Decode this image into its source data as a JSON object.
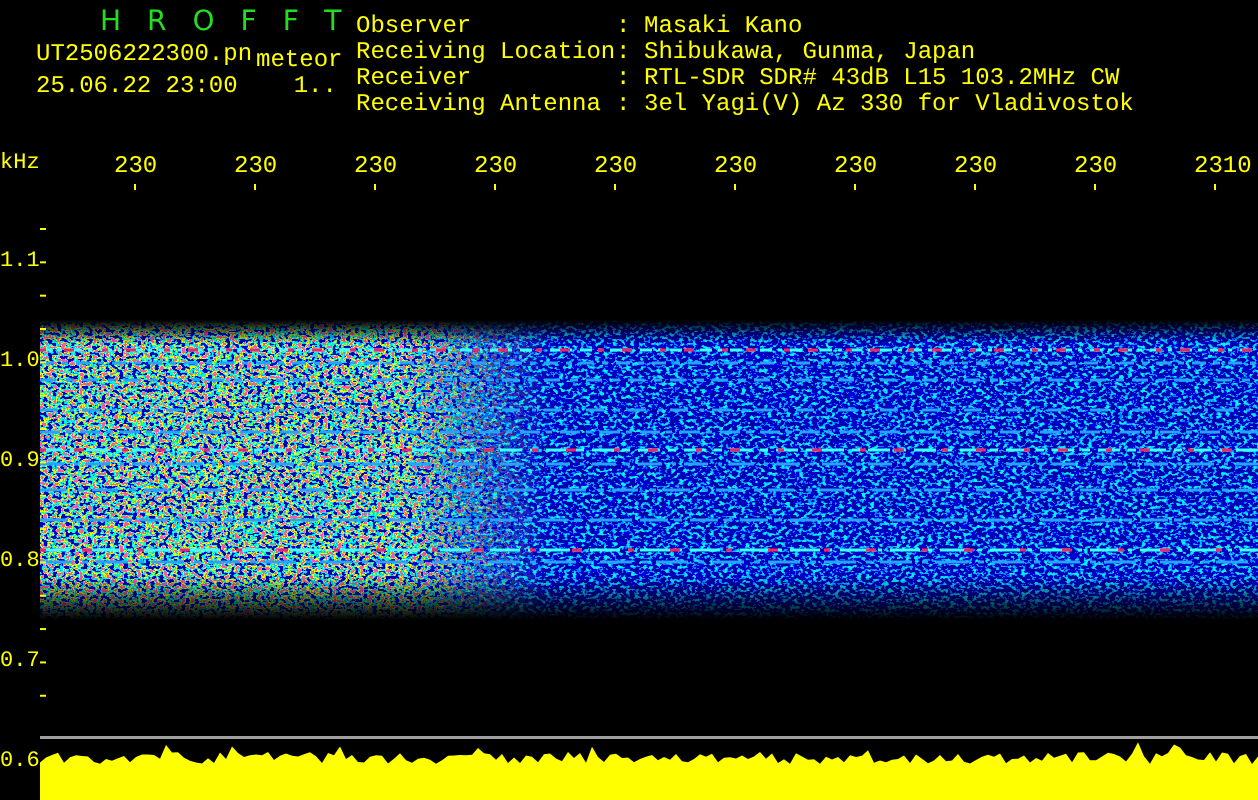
{
  "header": {
    "title": "HROFFT",
    "file_name": "UT2506222300.pn",
    "mode": "meteor",
    "date_time": "25.06.22 23:00",
    "note": "1.."
  },
  "info": [
    {
      "label": "Observer",
      "separator": ":",
      "value": "Masaki Kano"
    },
    {
      "label": "Receiving Location",
      "separator": ":",
      "value": "Shibukawa, Gunma, Japan"
    },
    {
      "label": "Receiver",
      "separator": ":",
      "value": "RTL-SDR SDR# 43dB L15 103.2MHz CW"
    },
    {
      "label": "Receiving Antenna",
      "separator": ":",
      "value": "3el Yagi(V) Az 330 for Vladivostok"
    }
  ],
  "x_axis": {
    "unit": "kHz",
    "ticks": [
      "230",
      "230",
      "230",
      "230",
      "230",
      "230",
      "230",
      "230",
      "230",
      "2310"
    ]
  },
  "y_axis": {
    "ticks": [
      "1.1",
      "1.0",
      "0.9",
      "0.8",
      "0.7",
      "0.6"
    ]
  }
}
